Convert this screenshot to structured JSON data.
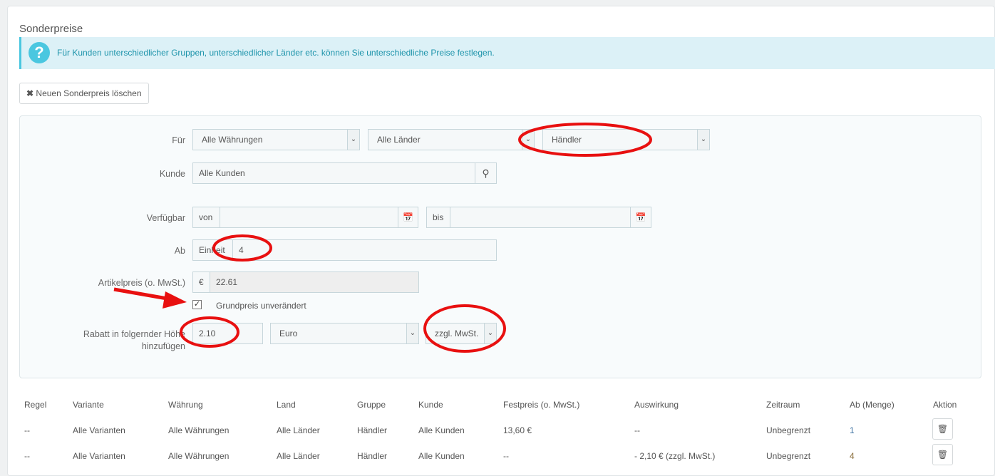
{
  "title": "Sonderpreise",
  "info": "Für Kunden unterschiedlicher Gruppen, unterschiedlicher Länder etc. können Sie unterschiedliche Preise festlegen.",
  "delete_button": "Neuen Sonderpreis löschen",
  "form": {
    "fuer_label": "Für",
    "currency": "Alle Währungen",
    "country": "Alle Länder",
    "group": "Händler",
    "kunde_label": "Kunde",
    "customer": "Alle Kunden",
    "verfuegbar_label": "Verfügbar",
    "from": "von",
    "to": "bis",
    "ab_label": "Ab",
    "unit": "Einheit",
    "quantity": "4",
    "price_label": "Artikelpreis (o. MwSt.)",
    "currency_symbol": "€",
    "price": "22.61",
    "keep_base_price": "Grundpreis unverändert",
    "keep_checked": true,
    "discount_label_1": "Rabatt in folgernder Höhe",
    "discount_label_2": "hinzufügen",
    "discount": "2.10",
    "discount_type": "Euro",
    "tax": "zzgl. MwSt."
  },
  "table": {
    "headers": [
      "Regel",
      "Variante",
      "Währung",
      "Land",
      "Gruppe",
      "Kunde",
      "Festpreis (o. MwSt.)",
      "Auswirkung",
      "Zeitraum",
      "Ab (Menge)",
      "Aktion"
    ],
    "rows": [
      [
        "--",
        "Alle Varianten",
        "Alle Währungen",
        "Alle Länder",
        "Händler",
        "Alle Kunden",
        "13,60 €",
        "--",
        "Unbegrenzt",
        "1"
      ],
      [
        "--",
        "Alle Varianten",
        "Alle Währungen",
        "Alle Länder",
        "Händler",
        "Alle Kunden",
        "--",
        "- 2,10 € (zzgl. MwSt.)",
        "Unbegrenzt",
        "4"
      ]
    ]
  },
  "colors": {
    "annotation": "#e81010",
    "info_bg": "#dcf1f7",
    "info_text": "#1e94ab"
  }
}
